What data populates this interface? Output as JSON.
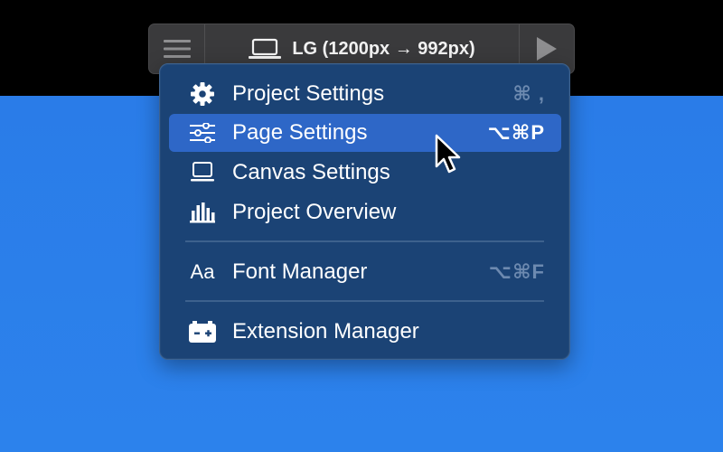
{
  "toolbar": {
    "menu_icon": "hamburger-icon",
    "breakpoint_icon": "laptop-icon",
    "breakpoint_label": "LG (1200px → 992px)",
    "play_icon": "play-icon"
  },
  "menu": {
    "items": [
      {
        "label": "Project Settings",
        "shortcut": "⌘ ,",
        "icon": "gear-icon",
        "selected": false
      },
      {
        "label": "Page Settings",
        "shortcut": "⌥⌘P",
        "icon": "sliders-icon",
        "selected": true
      },
      {
        "label": "Canvas Settings",
        "shortcut": "",
        "icon": "monitor-icon",
        "selected": false
      },
      {
        "label": "Project Overview",
        "shortcut": "",
        "icon": "bar-chart-icon",
        "selected": false
      },
      {
        "label": "Font Manager",
        "shortcut": "⌥⌘F",
        "icon": "font-icon",
        "icon_text": "Aa",
        "selected": false
      },
      {
        "label": "Extension Manager",
        "shortcut": "",
        "icon": "extension-icon",
        "selected": false
      }
    ]
  },
  "colors": {
    "canvas": "#2a7de8",
    "menu_bg": "#1b4375",
    "selected_bg": "#2e67c7",
    "toolbar_bg": "#3a3a3c"
  }
}
